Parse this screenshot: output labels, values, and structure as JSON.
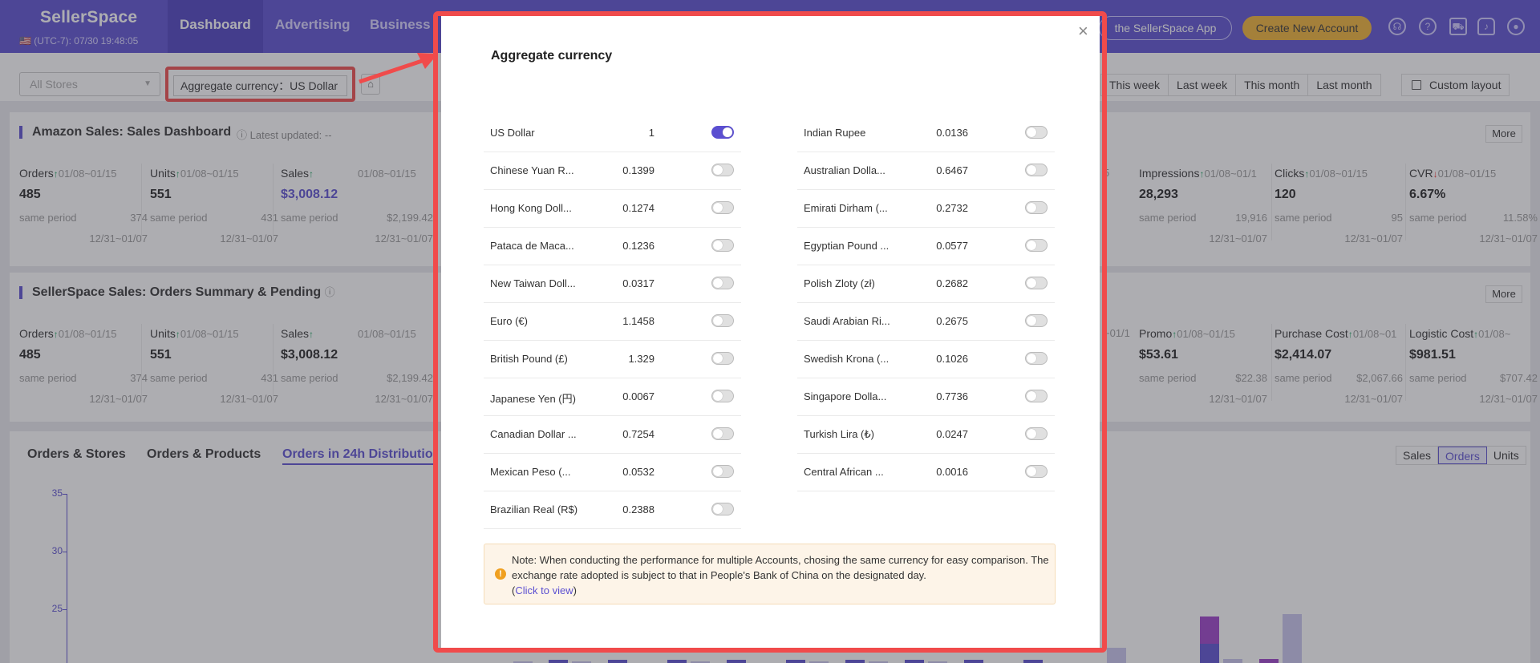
{
  "app": {
    "logo": "SellerSpace",
    "timezone": "(UTC-7): 07/30 19:48:05"
  },
  "nav": {
    "items": [
      "Dashboard",
      "Advertising",
      "Business"
    ],
    "active": "Dashboard"
  },
  "header": {
    "app_button": "the SellerSpace App",
    "create_button": "Create New Account",
    "icons": [
      "headset-icon",
      "help-icon",
      "cart-icon",
      "bell-icon",
      "user-icon"
    ]
  },
  "toolbar": {
    "store_placeholder": "All Stores",
    "aggregate_label": "Aggregate currency：US Dollar",
    "periods": [
      "This week",
      "Last week",
      "This month",
      "Last month"
    ],
    "custom_layout": "Custom layout"
  },
  "amazon": {
    "title": "Amazon Sales: Sales Dashboard",
    "updated": "Latest updated: --",
    "more": "More",
    "left_metrics": [
      {
        "label": "Orders",
        "trend": "↑",
        "range": "01/08~01/15",
        "value": "485",
        "same_label": "same period",
        "same_value": "374",
        "prev_range": "12/31~01/07"
      },
      {
        "label": "Units",
        "trend": "↑",
        "range": "01/08~01/15",
        "value": "551",
        "same_label": "same period",
        "same_value": "431",
        "prev_range": "12/31~01/07"
      },
      {
        "label": "Sales",
        "trend": "↑",
        "range": "01/08~01/15",
        "value": "$3,008.12",
        "same_label": "same period",
        "same_value": "$2,199.42",
        "prev_range": "12/31~01/07"
      }
    ],
    "right_metrics": [
      {
        "label": "Impressions",
        "trend": "↑",
        "range": "01/08~01/1",
        "value": "28,293",
        "same_label": "same period",
        "same_value": "19,916",
        "prev_range": "12/31~01/07"
      },
      {
        "label": "Clicks",
        "trend": "↑",
        "range": "01/08~01/15",
        "value": "120",
        "same_label": "same period",
        "same_value": "95",
        "prev_range": "12/31~01/07"
      },
      {
        "label": "CVR",
        "trend": "↓",
        "range": "01/08~01/15",
        "value": "6.67%",
        "same_label": "same period",
        "same_value": "11.58%",
        "prev_range": "12/31~01/07"
      }
    ],
    "clip_text": "5"
  },
  "sellerspace": {
    "title": "SellerSpace Sales: Orders Summary & Pending",
    "more": "More",
    "left_metrics": [
      {
        "label": "Orders",
        "trend": "↑",
        "range": "01/08~01/15",
        "value": "485",
        "same_label": "same period",
        "same_value": "374",
        "prev_range": "12/31~01/07"
      },
      {
        "label": "Units",
        "trend": "↑",
        "range": "01/08~01/15",
        "value": "551",
        "same_label": "same period",
        "same_value": "431",
        "prev_range": "12/31~01/07"
      },
      {
        "label": "Sales",
        "trend": "↑",
        "range": "01/08~01/15",
        "value": "$3,008.12",
        "same_label": "same period",
        "same_value": "$2,199.42",
        "prev_range": "12/31~01/07"
      }
    ],
    "right_metrics": [
      {
        "label": "Promo",
        "trend": "↑",
        "range": "01/08~01/15",
        "value": "$53.61",
        "same_label": "same period",
        "same_value": "$22.38",
        "prev_range": "12/31~01/07"
      },
      {
        "label": "Purchase Cost",
        "trend": "↑",
        "range": "01/08~01",
        "value": "$2,414.07",
        "same_label": "same period",
        "same_value": "$2,067.66",
        "prev_range": "12/31~01/07"
      },
      {
        "label": "Logistic Cost",
        "trend": "↑",
        "range": "01/08~",
        "value": "$981.51",
        "same_label": "same period",
        "same_value": "$707.42",
        "prev_range": "12/31~01/07"
      }
    ],
    "clip_text": "~01/1"
  },
  "chart_tabs": {
    "tabs": [
      "Orders & Stores",
      "Orders & Products",
      "Orders in 24h Distributio"
    ],
    "active": 2,
    "segments": [
      "Sales",
      "Orders",
      "Units"
    ],
    "active_segment": "Orders"
  },
  "chart_data": {
    "type": "bar",
    "yticks": [
      35,
      30,
      25
    ],
    "series_colors": [
      "#5b4fd1",
      "#c9c5ee",
      "#9b3fc9"
    ],
    "bars": [
      {
        "x": 640,
        "color": "#c9c5ee",
        "value": 20.5
      },
      {
        "x": 684,
        "color": "#5b4fd1",
        "value": 20.6
      },
      {
        "x": 713,
        "color": "#c9c5ee",
        "value": 20.5
      },
      {
        "x": 758,
        "color": "#5b4fd1",
        "value": 20.6
      },
      {
        "x": 832,
        "color": "#5b4fd1",
        "value": 20.6
      },
      {
        "x": 861,
        "color": "#c9c5ee",
        "value": 20.5
      },
      {
        "x": 906,
        "color": "#5b4fd1",
        "value": 20.6
      },
      {
        "x": 980,
        "color": "#5b4fd1",
        "value": 20.6
      },
      {
        "x": 1009,
        "color": "#c9c5ee",
        "value": 20.5
      },
      {
        "x": 1054,
        "color": "#5b4fd1",
        "value": 20.6
      },
      {
        "x": 1083,
        "color": "#c9c5ee",
        "value": 20.5
      },
      {
        "x": 1128,
        "color": "#5b4fd1",
        "value": 20.6
      },
      {
        "x": 1157,
        "color": "#c9c5ee",
        "value": 20.5
      },
      {
        "x": 1202,
        "color": "#5b4fd1",
        "value": 20.6
      },
      {
        "x": 1276,
        "color": "#5b4fd1",
        "value": 20.6
      },
      {
        "x": 1380,
        "color": "#c9c5ee",
        "value": 21.7
      },
      {
        "x": 1496,
        "color": "#5b4fd1",
        "value": 22.0
      },
      {
        "x": 1496,
        "color": "#9b3fc9",
        "value": 24.4,
        "base": 22.0
      },
      {
        "x": 1525,
        "color": "#c9c5ee",
        "value": 20.7
      },
      {
        "x": 1570,
        "color": "#9b3fc9",
        "value": 20.7
      },
      {
        "x": 1599,
        "color": "#c9c5ee",
        "value": 24.6
      }
    ]
  },
  "modal": {
    "title": "Aggregate currency",
    "close": "×",
    "left": [
      {
        "name": "US Dollar",
        "rate": "1",
        "on": true
      },
      {
        "name": "Chinese Yuan R...",
        "rate": "0.1399",
        "on": false
      },
      {
        "name": "Hong Kong Doll...",
        "rate": "0.1274",
        "on": false
      },
      {
        "name": "Pataca de Maca...",
        "rate": "0.1236",
        "on": false
      },
      {
        "name": "New Taiwan Doll...",
        "rate": "0.0317",
        "on": false
      },
      {
        "name": "Euro (€)",
        "rate": "1.1458",
        "on": false
      },
      {
        "name": "British Pound (£)",
        "rate": "1.329",
        "on": false
      },
      {
        "name": "Japanese Yen (円)",
        "rate": "0.0067",
        "on": false
      },
      {
        "name": "Canadian Dollar ...",
        "rate": "0.7254",
        "on": false
      },
      {
        "name": "Mexican Peso (...",
        "rate": "0.0532",
        "on": false
      },
      {
        "name": "Brazilian Real (R$)",
        "rate": "0.2388",
        "on": false
      }
    ],
    "right": [
      {
        "name": "Indian Rupee",
        "rate": "0.0136",
        "on": false
      },
      {
        "name": "Australian Dolla...",
        "rate": "0.6467",
        "on": false
      },
      {
        "name": "Emirati Dirham (...",
        "rate": "0.2732",
        "on": false
      },
      {
        "name": "Egyptian Pound ...",
        "rate": "0.0577",
        "on": false
      },
      {
        "name": "Polish Zloty (zł)",
        "rate": "0.2682",
        "on": false
      },
      {
        "name": "Saudi Arabian Ri...",
        "rate": "0.2675",
        "on": false
      },
      {
        "name": "Swedish Krona (...",
        "rate": "0.1026",
        "on": false
      },
      {
        "name": "Singapore Dolla...",
        "rate": "0.7736",
        "on": false
      },
      {
        "name": "Turkish Lira (₺)",
        "rate": "0.0247",
        "on": false
      },
      {
        "name": "Central African ...",
        "rate": "0.0016",
        "on": false
      }
    ],
    "note_icon": "!",
    "note": "Note: When conducting the performance for multiple Accounts, chosing the same currency for easy comparison. The exchange rate adopted is subject to that in People's Bank of China on the designated day.",
    "note_link_open": "(",
    "note_link": "Click to view",
    "note_link_close": ")"
  }
}
